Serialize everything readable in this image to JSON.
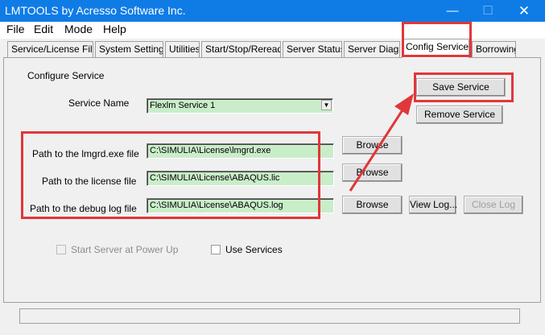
{
  "window": {
    "title": "LMTOOLS by Acresso Software Inc."
  },
  "menu": [
    "File",
    "Edit",
    "Mode",
    "Help"
  ],
  "tabs": [
    "Service/License File",
    "System Settings",
    "Utilities",
    "Start/Stop/Reread",
    "Server Status",
    "Server Diags",
    "Config Services",
    "Borrowing"
  ],
  "active_tab": "Config Services",
  "config": {
    "section_label": "Configure Service",
    "service_name_label": "Service Name",
    "service_name_value": "Flexlm Service 1",
    "lmgrd_label": "Path to the lmgrd.exe file",
    "lmgrd_value": "C:\\SIMULIA\\License\\lmgrd.exe",
    "license_label": "Path to the license file",
    "license_value": "C:\\SIMULIA\\License\\ABAQUS.lic",
    "debug_label": "Path to the debug log file",
    "debug_value": "C:\\SIMULIA\\License\\ABAQUS.log",
    "save_label": "Save Service",
    "remove_label": "Remove Service",
    "browse_label": "Browse",
    "view_log_label": "View Log...",
    "close_log_label": "Close Log",
    "start_server_label": "Start Server at Power Up",
    "use_services_label": "Use Services"
  },
  "colors": {
    "titlebar": "#0f7ce6",
    "field_bg": "#c9edc9",
    "annotation": "#e0373b"
  }
}
